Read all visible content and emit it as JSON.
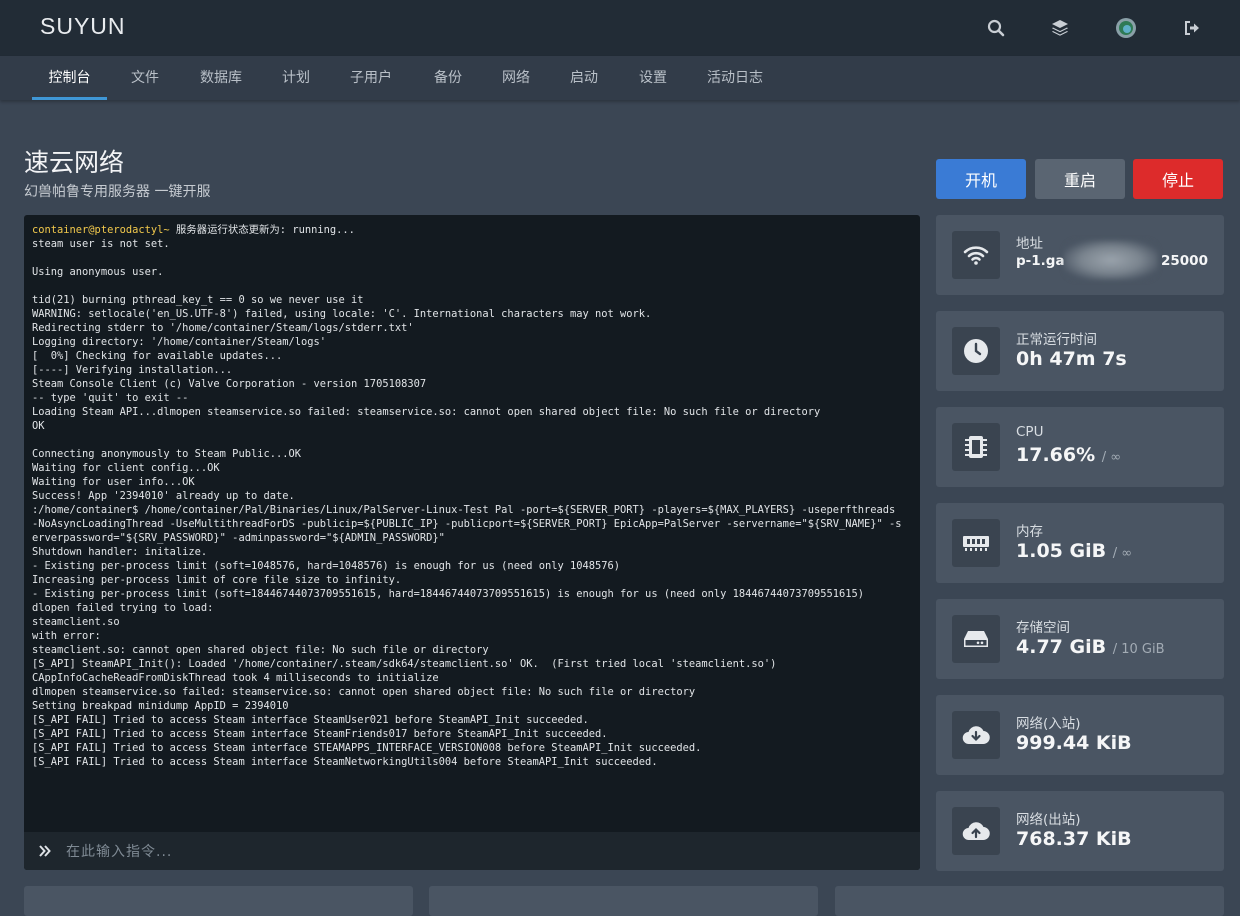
{
  "brand": "SUYUN",
  "header_icons": [
    "search-icon",
    "layers-icon",
    "avatar",
    "logout-icon"
  ],
  "nav": {
    "items": [
      {
        "label": "控制台",
        "active": true
      },
      {
        "label": "文件"
      },
      {
        "label": "数据库"
      },
      {
        "label": "计划"
      },
      {
        "label": "子用户"
      },
      {
        "label": "备份"
      },
      {
        "label": "网络"
      },
      {
        "label": "启动"
      },
      {
        "label": "设置"
      },
      {
        "label": "活动日志"
      }
    ]
  },
  "server": {
    "name": "速云网络",
    "description": "幻兽帕鲁专用服务器 一键开服"
  },
  "controls": {
    "start": "开机",
    "restart": "重启",
    "stop": "停止",
    "colors": {
      "start": "#3a7bd5",
      "restart": "#5a6572",
      "stop": "#dd2b2b"
    }
  },
  "console": {
    "prompt": "container@pterodactyl~",
    "first_line_text": " 服务器运行状态更新为: running...",
    "lines": [
      "steam user is not set.",
      "",
      "Using anonymous user.",
      "",
      "tid(21) burning pthread_key_t == 0 so we never use it",
      "WARNING: setlocale('en_US.UTF-8') failed, using locale: 'C'. International characters may not work.",
      "Redirecting stderr to '/home/container/Steam/logs/stderr.txt'",
      "Logging directory: '/home/container/Steam/logs'",
      "[  0%] Checking for available updates...",
      "[----] Verifying installation...",
      "Steam Console Client (c) Valve Corporation - version 1705108307",
      "-- type 'quit' to exit --",
      "Loading Steam API...dlmopen steamservice.so failed: steamservice.so: cannot open shared object file: No such file or directory",
      "OK",
      "",
      "Connecting anonymously to Steam Public...OK",
      "Waiting for client config...OK",
      "Waiting for user info...OK",
      "Success! App '2394010' already up to date.",
      ":/home/container$ /home/container/Pal/Binaries/Linux/PalServer-Linux-Test Pal -port=${SERVER_PORT} -players=${MAX_PLAYERS} -useperfthreads -NoAsyncLoadingThread -UseMultithreadForDS -publicip=${PUBLIC_IP} -publicport=${SERVER_PORT} EpicApp=PalServer -servername=\"${SRV_NAME}\" -serverpassword=\"${SRV_PASSWORD}\" -adminpassword=\"${ADMIN_PASSWORD}\"",
      "Shutdown handler: initalize.",
      "- Existing per-process limit (soft=1048576, hard=1048576) is enough for us (need only 1048576)",
      "Increasing per-process limit of core file size to infinity.",
      "- Existing per-process limit (soft=18446744073709551615, hard=18446744073709551615) is enough for us (need only 18446744073709551615)",
      "dlopen failed trying to load:",
      "steamclient.so",
      "with error:",
      "steamclient.so: cannot open shared object file: No such file or directory",
      "[S_API] SteamAPI_Init(): Loaded '/home/container/.steam/sdk64/steamclient.so' OK.  (First tried local 'steamclient.so')",
      "CAppInfoCacheReadFromDiskThread took 4 milliseconds to initialize",
      "dlmopen steamservice.so failed: steamservice.so: cannot open shared object file: No such file or directory",
      "Setting breakpad minidump AppID = 2394010",
      "[S_API FAIL] Tried to access Steam interface SteamUser021 before SteamAPI_Init succeeded.",
      "[S_API FAIL] Tried to access Steam interface SteamFriends017 before SteamAPI_Init succeeded.",
      "[S_API FAIL] Tried to access Steam interface STEAMAPPS_INTERFACE_VERSION008 before SteamAPI_Init succeeded.",
      "[S_API FAIL] Tried to access Steam interface SteamNetworkingUtils004 before SteamAPI_Init succeeded."
    ],
    "input_placeholder": "在此输入指令..."
  },
  "stats": {
    "address": {
      "label": "地址",
      "value_start": "p-1.ga",
      "value_end": "25000",
      "icon": "wifi-icon"
    },
    "uptime": {
      "label": "正常运行时间",
      "value": "0h 47m 7s",
      "icon": "clock-icon"
    },
    "cpu": {
      "label": "CPU",
      "value": "17.66%",
      "limit": "/ ∞",
      "icon": "cpu-icon"
    },
    "memory": {
      "label": "内存",
      "value": "1.05 GiB",
      "limit": "/ ∞",
      "icon": "memory-icon"
    },
    "storage": {
      "label": "存储空间",
      "value": "4.77 GiB",
      "limit": "/ 10 GiB",
      "icon": "hdd-icon"
    },
    "net_in": {
      "label": "网络(入站)",
      "value": "999.44 KiB",
      "icon": "cloud-download-icon"
    },
    "net_out": {
      "label": "网络(出站)",
      "value": "768.37 KiB",
      "icon": "cloud-upload-icon"
    }
  }
}
